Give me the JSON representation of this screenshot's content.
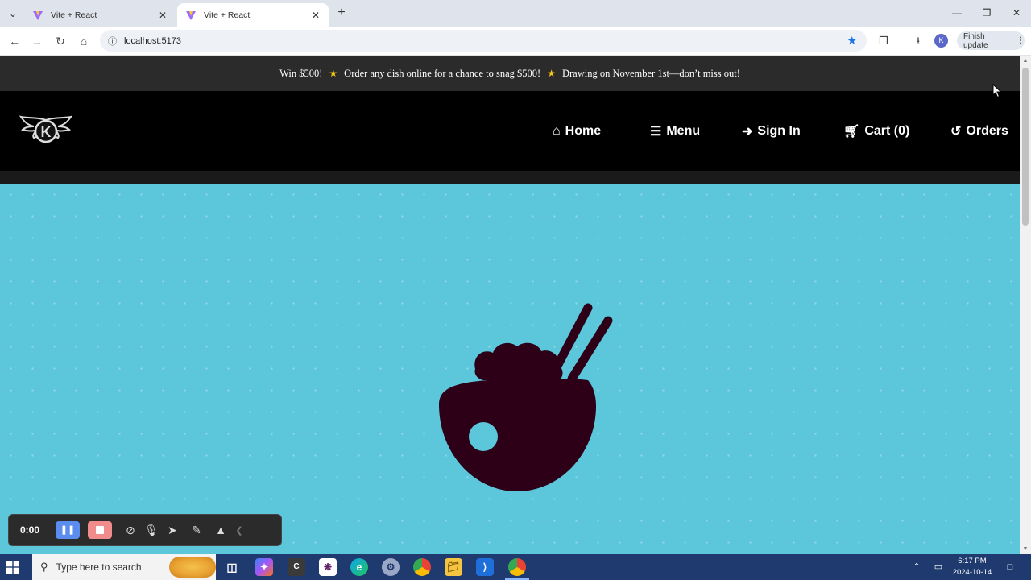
{
  "browser": {
    "tabs": [
      {
        "title": "Vite + React",
        "active": false
      },
      {
        "title": "Vite + React",
        "active": true
      }
    ],
    "url": "localhost:5173",
    "finish_update_label": "Finish update",
    "profile_initial": "K"
  },
  "promo": {
    "part1": "Win $500!",
    "part2": "Order any dish online for a chance to snag $500!",
    "part3": "Drawing on November 1st—don’t miss out!"
  },
  "nav": {
    "home": "Home",
    "menu": "Menu",
    "sign_in": "Sign In",
    "cart": "Cart (0)",
    "orders": "Orders"
  },
  "logo": {
    "letter": "K"
  },
  "recorder": {
    "time": "0:00"
  },
  "taskbar": {
    "search_placeholder": "Type here to search",
    "time": "6:17 PM",
    "date": "2024-10-14"
  },
  "colors": {
    "hero_bg": "#5cc6da",
    "nav_bg": "#000000",
    "promo_bg": "#2b2b2b",
    "bowl": "#2d0018",
    "promo_star": "#f5c518"
  }
}
